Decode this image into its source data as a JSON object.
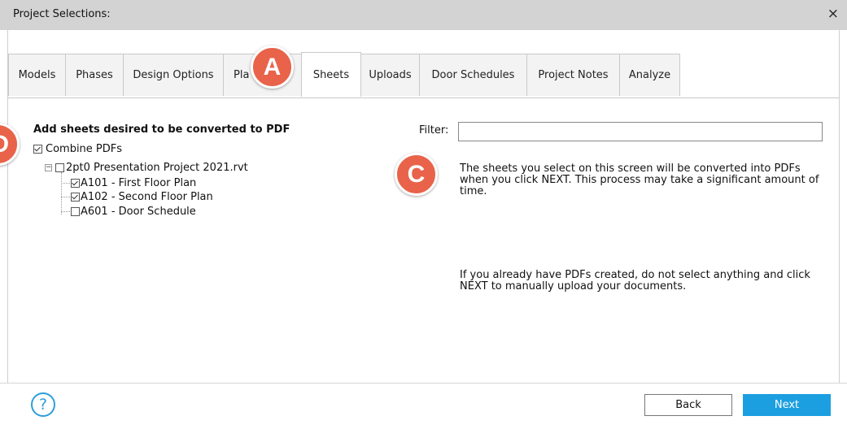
{
  "window": {
    "title": "Project Selections:",
    "close_glyph": "×"
  },
  "tabs": [
    {
      "label": "Models",
      "active": false
    },
    {
      "label": "Phases",
      "active": false
    },
    {
      "label": "Design Options",
      "active": false
    },
    {
      "label": "Pla",
      "active": false
    },
    {
      "label": "Sheets",
      "active": true
    },
    {
      "label": "Uploads",
      "active": false
    },
    {
      "label": "Door Schedules",
      "active": false
    },
    {
      "label": "Project Notes",
      "active": false
    },
    {
      "label": "Analyze",
      "active": false
    }
  ],
  "sheets_panel": {
    "heading": "Add sheets desired to be converted to PDF",
    "combine_label": "Combine PDFs",
    "combine_checked": true,
    "tree": {
      "root_label": "2pt0 Presentation Project 2021.rvt",
      "root_expander": "−",
      "items": [
        {
          "label": "A101 - First Floor Plan",
          "checked": true
        },
        {
          "label": "A102 - Second Floor Plan",
          "checked": true
        },
        {
          "label": "A601 - Door Schedule",
          "checked": false
        }
      ]
    }
  },
  "filter": {
    "label": "Filter:",
    "value": ""
  },
  "info": {
    "text1": "The sheets you select on this screen will be converted into PDFs when you click NEXT. This process may take a significant amount of time.",
    "text2": "If you already have PDFs created, do not select anything and click NEXT to manually upload your documents."
  },
  "callouts": {
    "a": "A",
    "c": "C",
    "d": "D"
  },
  "footer": {
    "help_glyph": "?",
    "back_label": "Back",
    "next_label": "Next"
  },
  "colors": {
    "accent": "#1c9fe0",
    "callout": "#e8634a",
    "titlebar": "#d3d3d3"
  }
}
